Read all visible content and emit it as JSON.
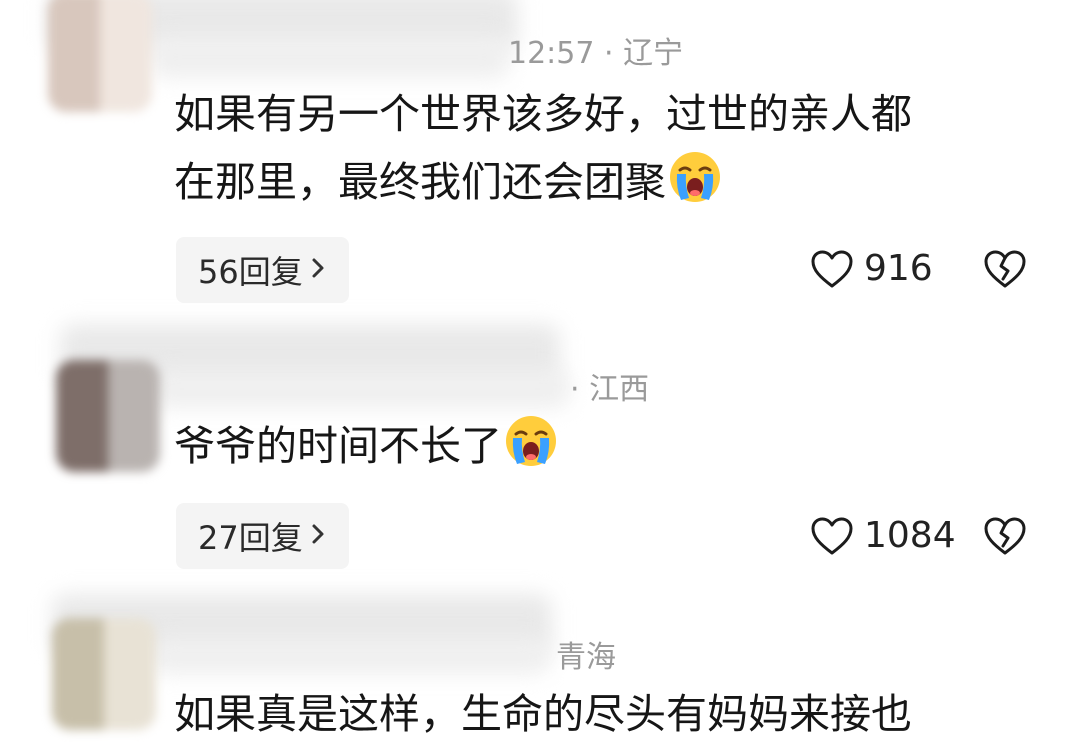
{
  "comments": [
    {
      "meta_time": "12:57",
      "meta_sep": " · ",
      "location": "辽宁",
      "lines": [
        "如果有另一个世界该多好，过世的亲人都",
        "在那里，最终我们还会团聚"
      ],
      "emoji": "crying-face-icon",
      "replies_label": "56回复",
      "likes": "916",
      "avatar_colors": [
        "#d8c7bd",
        "#f0e6df"
      ]
    },
    {
      "meta_sep": "· ",
      "location": "江西",
      "lines": [
        "爷爷的时间不长了"
      ],
      "emoji": "crying-face-icon",
      "replies_label": "27回复",
      "likes": "1084",
      "avatar_colors": [
        "#7e6e69",
        "#b9b3b0"
      ]
    },
    {
      "location": "青海",
      "lines": [
        "如果真是这样，生命的尽头有妈妈来接也"
      ],
      "avatar_colors": [
        "#c7bfa9",
        "#e8e2d5"
      ]
    }
  ],
  "icons": {
    "heart": "heart-outline-icon",
    "broken_heart": "broken-heart-icon",
    "chevron": "chevron-right-icon"
  },
  "colors": {
    "meta_text": "#9a9a9a",
    "pill_bg": "#f4f4f4",
    "emoji_face": "#ffcd3c",
    "emoji_tears": "#3aa0ff"
  }
}
